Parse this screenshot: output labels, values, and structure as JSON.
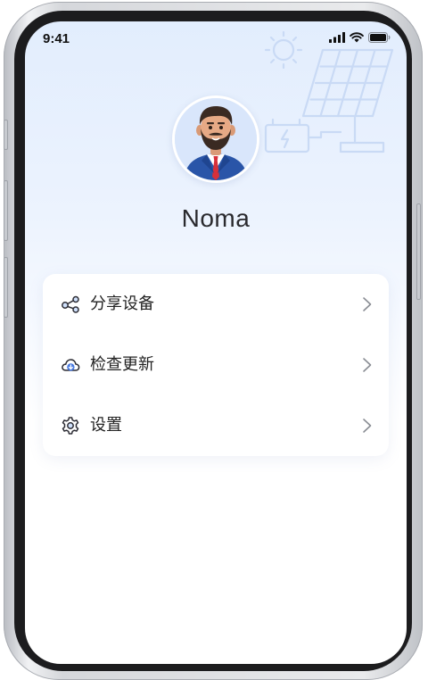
{
  "status_bar": {
    "time": "9:41"
  },
  "profile": {
    "name": "Noma"
  },
  "menu": {
    "items": [
      {
        "label": "分享设备",
        "icon": "share-icon"
      },
      {
        "label": "检查更新",
        "icon": "cloud-download-icon"
      },
      {
        "label": "设置",
        "icon": "gear-icon"
      }
    ]
  },
  "colors": {
    "accent": "#4a7be0",
    "background_top": "#e2edfd",
    "card": "#ffffff",
    "text": "#222222"
  }
}
